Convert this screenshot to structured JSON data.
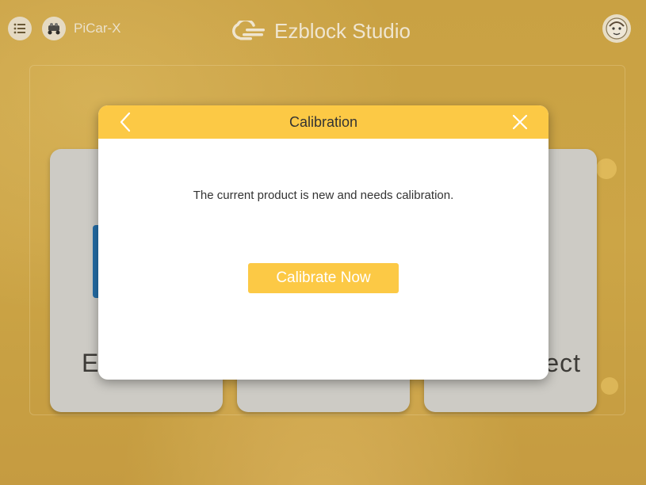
{
  "app": {
    "device_name": "PiCar-X",
    "brand_name": "Ezblock Studio"
  },
  "cards": [
    {
      "label": "Ex"
    },
    {
      "label": ""
    },
    {
      "label": "ect"
    }
  ],
  "dialog": {
    "title": "Calibration",
    "message": "The current product is new and needs calibration.",
    "primary_button": "Calibrate Now"
  },
  "icons": {
    "menu": "menu-icon",
    "device": "robot-car-icon",
    "brand": "cloud-logo-icon",
    "avatar": "user-avatar-icon",
    "back": "chevron-left-icon",
    "close": "close-icon"
  },
  "colors": {
    "background": "#cfa647",
    "accent": "#fcc945",
    "card": "#d3d3d1",
    "dialog_bg": "#ffffff"
  }
}
